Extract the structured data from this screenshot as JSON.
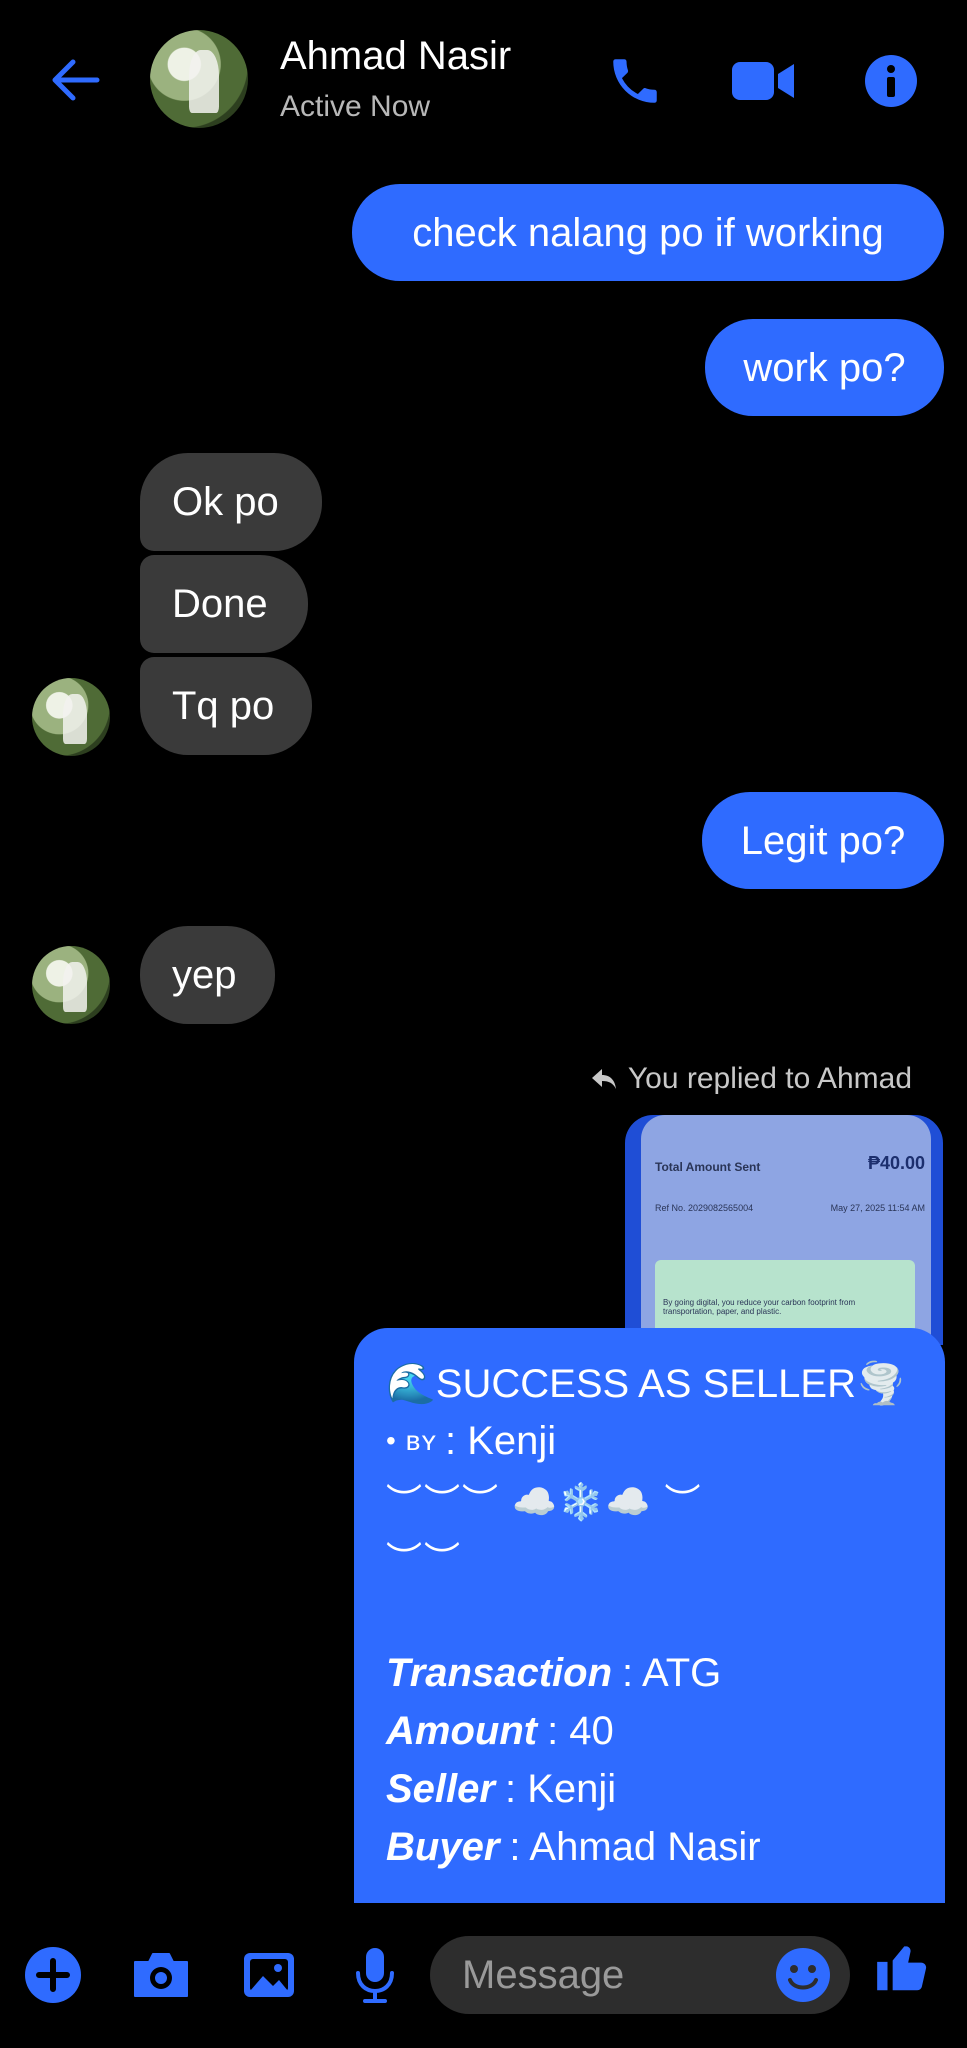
{
  "contact": {
    "name": "Ahmad Nasir",
    "status": "Active Now"
  },
  "header": {
    "icons": [
      "back-arrow-icon",
      "phone-icon",
      "video-icon",
      "info-icon"
    ]
  },
  "messages": [
    {
      "from": "me",
      "text": "check nalang po if working"
    },
    {
      "from": "me",
      "text": "work po?"
    },
    {
      "from": "them",
      "text": "Ok po"
    },
    {
      "from": "them",
      "text": "Done"
    },
    {
      "from": "them",
      "text": "Tq po"
    },
    {
      "from": "me",
      "text": "Legit po?"
    },
    {
      "from": "them",
      "text": "yep"
    }
  ],
  "reply": {
    "label": "You replied to Ahmad",
    "thumbnail": {
      "title": "Total Amount Sent",
      "amount": "₱40.00",
      "ref": "Ref No. 2029082565004",
      "date": "May 27, 2025 11:54 AM",
      "eco_text": "By going digital, you reduce your carbon footprint from transportation, paper, and plastic."
    }
  },
  "card": {
    "title": "🌊SUCCESS AS SELLER🌪️",
    "by_label": "• ʙʏ",
    "by_value": ": Kenji",
    "deco1": "︶︶︶ ☁️❄️☁️ ︶",
    "deco2": "︶︶",
    "fields": [
      {
        "label": "Transaction",
        "value": ": ATG"
      },
      {
        "label": "Amount",
        "value": ": 40"
      },
      {
        "label": "Seller",
        "value": ": Kenji"
      },
      {
        "label": "Buyer",
        "value": ": Ahmad Nasir"
      }
    ]
  },
  "composer": {
    "placeholder": "Message"
  },
  "colors": {
    "accent": "#2f6bff",
    "incoming": "#3a3a3a",
    "background": "#000000"
  }
}
